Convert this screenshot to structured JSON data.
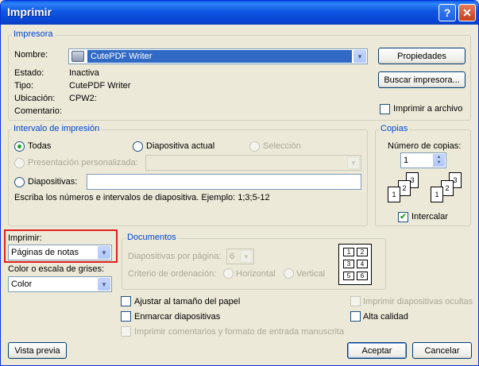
{
  "window": {
    "title": "Imprimir",
    "help_glyph": "?",
    "close_glyph": "✕"
  },
  "printer": {
    "group_label": "Impresora",
    "name_label": "Nombre:",
    "name_value": "CutePDF Writer",
    "status_label": "Estado:",
    "status_value": "Inactiva",
    "type_label": "Tipo:",
    "type_value": "CutePDF Writer",
    "location_label": "Ubicación:",
    "location_value": "CPW2:",
    "comment_label": "Comentario:",
    "properties_button": "Propiedades",
    "find_button": "Buscar impresora...",
    "print_to_file": "Imprimir a archivo"
  },
  "range": {
    "group_label": "Intervalo de impresión",
    "all": "Todas",
    "current": "Diapositiva actual",
    "selection": "Selección",
    "custom": "Presentación personalizada:",
    "slides": "Diapositivas:",
    "slides_value": "",
    "hint": "Escriba los números e intervalos de diapositiva. Ejemplo: 1;3;5-12"
  },
  "copies": {
    "group_label": "Copias",
    "count_label": "Número de copias:",
    "count_value": "1",
    "collate": "Intercalar",
    "collate_checked": true,
    "page_nums": [
      "1",
      "2",
      "3"
    ]
  },
  "print_what": {
    "label": "Imprimir:",
    "value": "Páginas de notas"
  },
  "color": {
    "label": "Color o escala de grises:",
    "value": "Color"
  },
  "handouts": {
    "group_label": "Documentos",
    "per_page_label": "Diapositivas por página:",
    "per_page_value": "6",
    "order_label": "Criterio de ordenación:",
    "horizontal": "Horizontal",
    "vertical": "Vertical",
    "preview_nums": [
      "1",
      "2",
      "3",
      "4",
      "5",
      "6"
    ]
  },
  "options": {
    "scale_to_fit": "Ajustar al tamaño del papel",
    "frame_slides": "Enmarcar diapositivas",
    "print_comments": "Imprimir comentarios y formato de entrada manuscrita",
    "print_hidden": "Imprimir diapositivas ocultas",
    "high_quality": "Alta calidad"
  },
  "footer": {
    "preview": "Vista previa",
    "ok": "Aceptar",
    "cancel": "Cancelar"
  }
}
